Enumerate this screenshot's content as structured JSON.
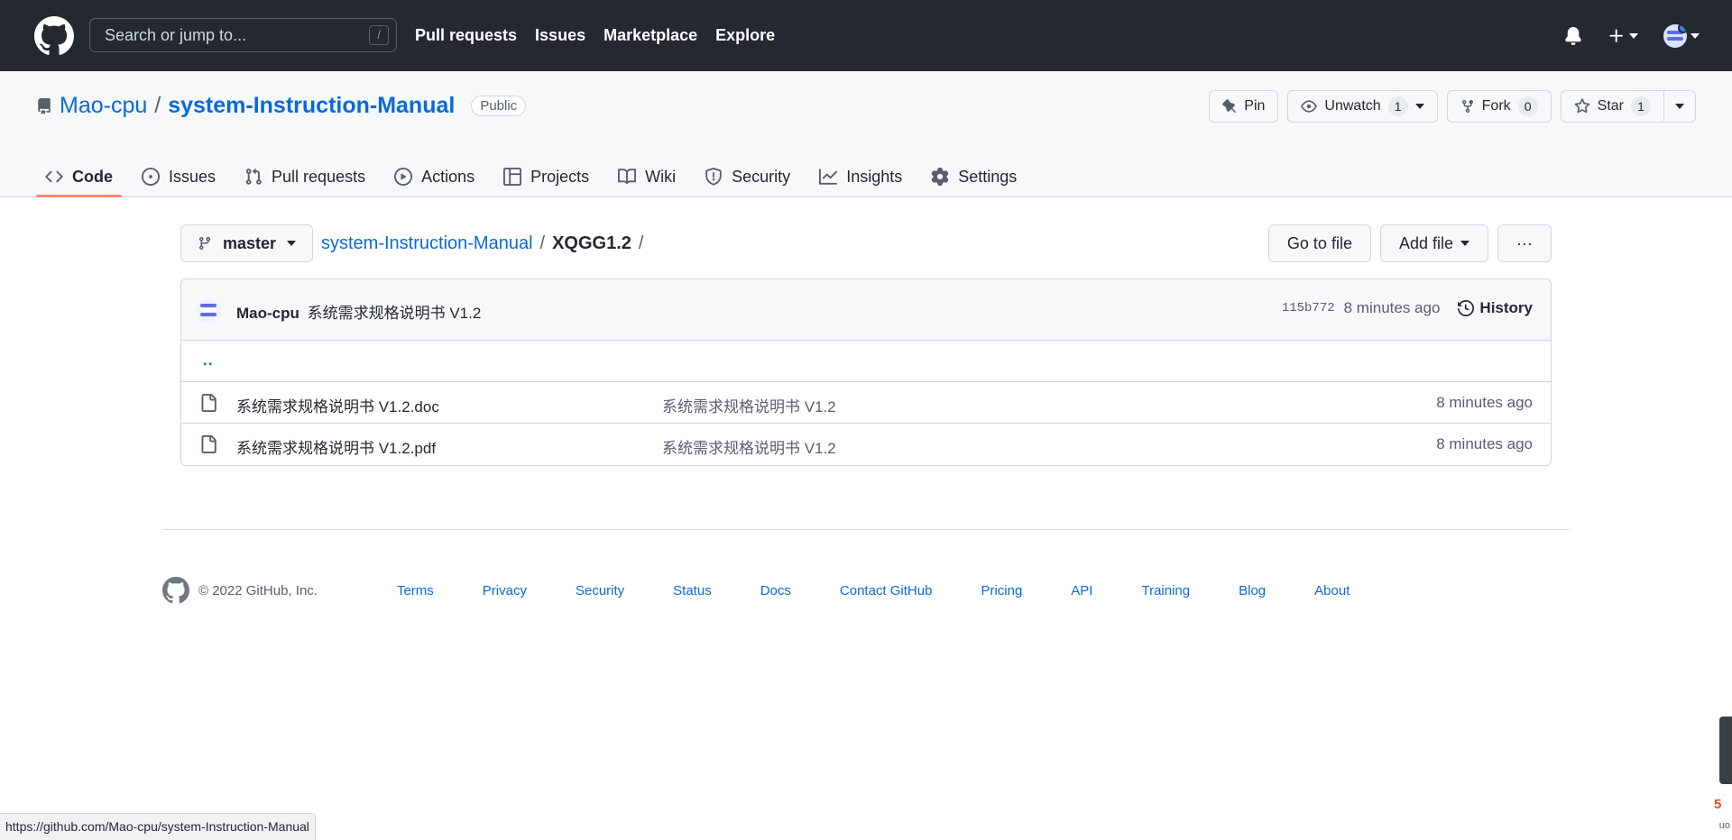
{
  "header": {
    "search_placeholder": "Search or jump to...",
    "search_shortcut": "/",
    "nav": [
      "Pull requests",
      "Issues",
      "Marketplace",
      "Explore"
    ]
  },
  "repo": {
    "owner": "Mao-cpu",
    "separator": "/",
    "name": "system-Instruction-Manual",
    "visibility": "Public",
    "pin_label": "Pin",
    "unwatch_label": "Unwatch",
    "unwatch_count": "1",
    "fork_label": "Fork",
    "fork_count": "0",
    "star_label": "Star",
    "star_count": "1"
  },
  "tabs": [
    "Code",
    "Issues",
    "Pull requests",
    "Actions",
    "Projects",
    "Wiki",
    "Security",
    "Insights",
    "Settings"
  ],
  "filebar": {
    "branch": "master",
    "crumb_repo": "system-Instruction-Manual",
    "crumb_sep": "/",
    "crumb_dir": "XQGG1.2",
    "crumb_trail": "/",
    "go_to_file": "Go to file",
    "add_file": "Add file",
    "more": "···"
  },
  "commit": {
    "author": "Mao-cpu",
    "message": "系统需求规格说明书 V1.2",
    "sha": "115b772",
    "age": "8 minutes ago",
    "history_label": "History"
  },
  "files": {
    "parent": "..",
    "items": [
      {
        "name": "系统需求规格说明书 V1.2.doc",
        "commit": "系统需求规格说明书 V1.2",
        "age": "8 minutes ago"
      },
      {
        "name": "系统需求规格说明书 V1.2.pdf",
        "commit": "系统需求规格说明书 V1.2",
        "age": "8 minutes ago"
      }
    ]
  },
  "footer": {
    "copyright": "© 2022 GitHub, Inc.",
    "links": [
      "Terms",
      "Privacy",
      "Security",
      "Status",
      "Docs",
      "Contact GitHub",
      "Pricing",
      "API",
      "Training",
      "Blog",
      "About"
    ]
  },
  "statusbar": {
    "url": "https://github.com/Mao-cpu/system-Instruction-Manual"
  },
  "edge": {
    "label": "uo"
  },
  "colors": {
    "header_bg": "#24292f",
    "link": "#0969da",
    "active_tab_underline": "#fd8c73",
    "muted": "#57606a",
    "border": "#d0d7de"
  }
}
